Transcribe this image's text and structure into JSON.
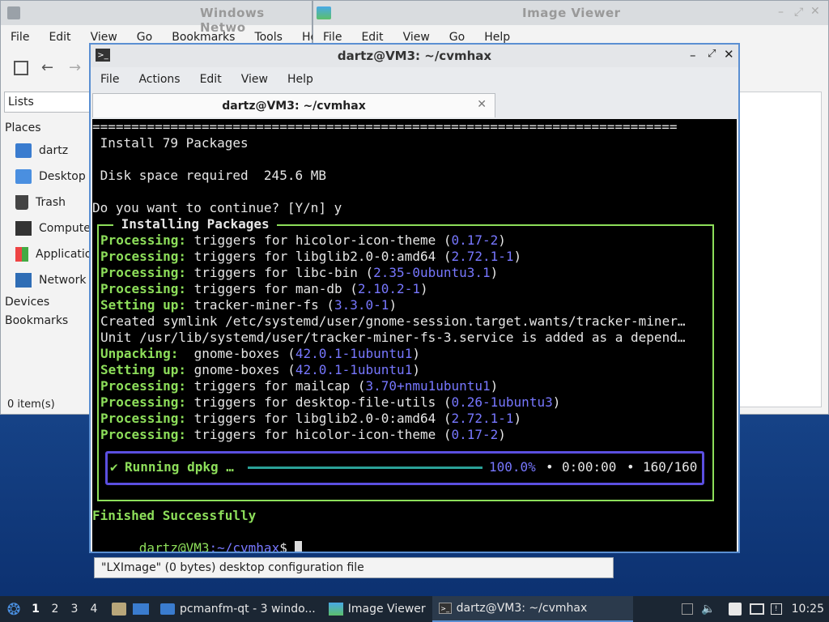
{
  "file_manager": {
    "title": "Windows Netwo",
    "menu": [
      "File",
      "Edit",
      "View",
      "Go",
      "Bookmarks",
      "Tools",
      "Help"
    ],
    "side_pane_label": "Lists",
    "places_label": "Places",
    "places": [
      {
        "label": "dartz",
        "icon": "home-folder-icon"
      },
      {
        "label": "Desktop",
        "icon": "desktop-icon"
      },
      {
        "label": "Trash",
        "icon": "trash-icon"
      },
      {
        "label": "Compute",
        "icon": "computer-icon"
      },
      {
        "label": "Applicatio",
        "icon": "applications-icon"
      },
      {
        "label": "Network",
        "icon": "network-icon"
      }
    ],
    "devices_label": "Devices",
    "bookmarks_label": "Bookmarks",
    "status": "0 item(s)",
    "status_selected": "\"LXImage\" (0 bytes) desktop configuration file"
  },
  "image_viewer": {
    "title": "Image Viewer",
    "menu": [
      "File",
      "Edit",
      "View",
      "Go",
      "Help"
    ]
  },
  "terminal": {
    "title": "dartz@VM3: ~/cvmhax",
    "menu": [
      "File",
      "Actions",
      "Edit",
      "View",
      "Help"
    ],
    "tab_title": "dartz@VM3: ~/cvmhax",
    "lines": {
      "rule": "===========================================================================",
      "install": " Install 79 Packages",
      "disk": " Disk space required  245.6 MB",
      "question": "Do you want to continue? [Y/n] y",
      "box_title": " Installing Packages ",
      "symlink": "Created symlink /etc/systemd/user/gnome-session.target.wants/tracker-miner…",
      "unit": "Unit /usr/lib/systemd/user/tracker-miner-fs-3.service is added as a depend…",
      "finished": "Finished Successfully",
      "prompt_user": "dartz@VM3",
      "prompt_path": ":~/cvmhax",
      "prompt_dollar": "$ "
    },
    "log": [
      {
        "kw": "Processing:",
        "text": " triggers for hicolor-icon-theme (",
        "ver": "0.17-2",
        "end": ")"
      },
      {
        "kw": "Processing:",
        "text": " triggers for libglib2.0-0:amd64 (",
        "ver": "2.72.1-1",
        "end": ")"
      },
      {
        "kw": "Processing:",
        "text": " triggers for libc-bin (",
        "ver": "2.35-0ubuntu3.1",
        "end": ")"
      },
      {
        "kw": "Processing:",
        "text": " triggers for man-db (",
        "ver": "2.10.2-1",
        "end": ")"
      },
      {
        "kw": "Setting up:",
        "text": " tracker-miner-fs (",
        "ver": "3.3.0-1",
        "end": ")"
      },
      {
        "kw": "Unpacking: ",
        "text": " gnome-boxes (",
        "ver": "42.0.1-1ubuntu1",
        "end": ")"
      },
      {
        "kw": "Setting up:",
        "text": " gnome-boxes (",
        "ver": "42.0.1-1ubuntu1",
        "end": ")"
      },
      {
        "kw": "Processing:",
        "text": " triggers for mailcap (",
        "ver": "3.70+nmu1ubuntu1",
        "end": ")"
      },
      {
        "kw": "Processing:",
        "text": " triggers for desktop-file-utils (",
        "ver": "0.26-1ubuntu3",
        "end": ")"
      },
      {
        "kw": "Processing:",
        "text": " triggers for libglib2.0-0:amd64 (",
        "ver": "2.72.1-1",
        "end": ")"
      },
      {
        "kw": "Processing:",
        "text": " triggers for hicolor-icon-theme (",
        "ver": "0.17-2",
        "end": ")"
      }
    ],
    "progress": {
      "check": "✔",
      "label": "Running dpkg …",
      "percent_text": "100.0%",
      "elapsed": "0:00:00",
      "count": "160/160",
      "fraction": 1.0
    }
  },
  "taskbar": {
    "workspaces": [
      "1",
      "2",
      "3",
      "4"
    ],
    "tasks": [
      {
        "label": "pcmanfm-qt - 3 windo...",
        "icon": "folder-icon"
      },
      {
        "label": "Image Viewer",
        "icon": "image-icon"
      },
      {
        "label": "dartz@VM3: ~/cvmhax",
        "icon": "terminal-icon"
      }
    ],
    "clock": "10:25"
  },
  "colors": {
    "term_green": "#8dde5a",
    "term_blue": "#7777ff",
    "progress_border": "#5b4fe0",
    "progress_bar": "#2aa198",
    "accent": "#5a8fd2"
  }
}
